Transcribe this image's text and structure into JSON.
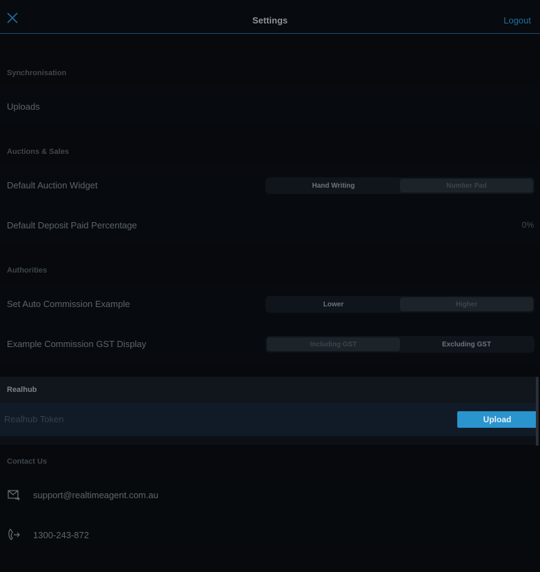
{
  "header": {
    "title": "Settings",
    "logout_label": "Logout",
    "close_icon": "close-icon"
  },
  "sections": {
    "synchronisation": {
      "title": "Synchronisation",
      "uploads_label": "Uploads"
    },
    "auctions_sales": {
      "title": "Auctions & Sales",
      "default_widget_label": "Default Auction Widget",
      "widget_options": [
        "Hand Writing",
        "Number Pad"
      ],
      "widget_selected": "Number Pad",
      "deposit_label": "Default Deposit Paid Percentage",
      "deposit_value": "0%"
    },
    "authorities": {
      "title": "Authorities",
      "auto_commission_label": "Set Auto Commission Example",
      "auto_commission_options": [
        "Lower",
        "Higher"
      ],
      "auto_commission_selected": "Higher",
      "gst_display_label": "Example Commission GST Display",
      "gst_options": [
        "Including GST",
        "Excluding GST"
      ],
      "gst_selected": "Including GST"
    },
    "realhub": {
      "title": "Realhub",
      "token_label": "Realhub Token",
      "upload_label": "Upload"
    },
    "contact": {
      "title": "Contact Us",
      "email": "support@realtimeagent.com.au",
      "phone": "1300-243-872",
      "email_icon": "mail-icon",
      "phone_icon": "phone-icon"
    }
  },
  "colors": {
    "accent": "#2a94cf",
    "header_border": "#1c4f73",
    "background": "#07090c"
  }
}
